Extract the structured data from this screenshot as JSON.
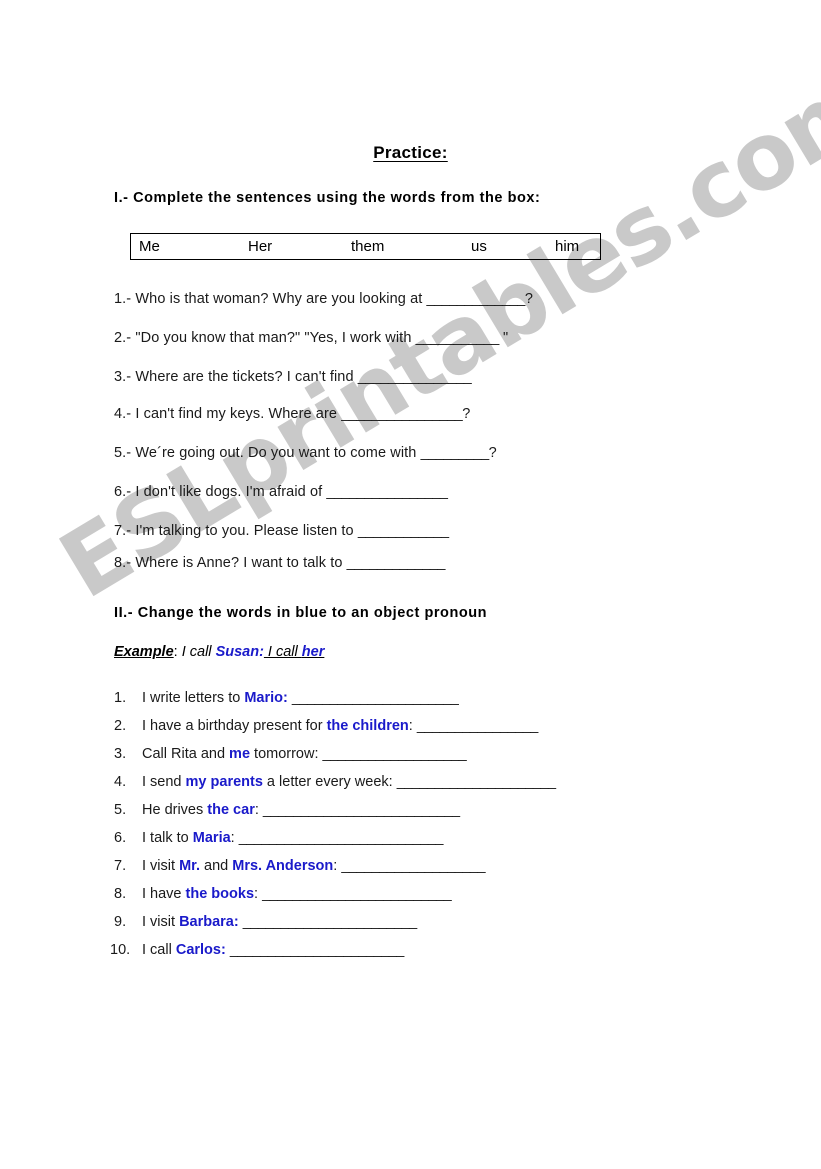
{
  "document": {
    "title": "Practice:",
    "watermark": "ESLprintables.com",
    "accent_blue": "#1a1aca",
    "text_color": "#1a1a1a"
  },
  "section1": {
    "heading": "I.- Complete the sentences using the words from the box:",
    "word_box": [
      "Me",
      "Her",
      "them",
      "us",
      "him"
    ],
    "items": [
      {
        "number": "1.-",
        "text": "Who is that woman?  Why are you looking at ",
        "blank": "_____________",
        "tail": "?"
      },
      {
        "number": "2.-",
        "text": "\"Do you know that man?\"  \"Yes, I work with ",
        "blank": "___________",
        "tail": " \""
      },
      {
        "number": "3.-",
        "text": "Where are the tickets? I can't find ",
        "blank": "_______________",
        "tail": ""
      },
      {
        "number": "4.-",
        "text": "I can't find my keys. Where are ",
        "blank": "________________",
        "tail": "?"
      },
      {
        "number": "5.-",
        "text": "We´re going out. Do you want to come with ",
        "blank": "_________",
        "tail": "?"
      },
      {
        "number": "6.-",
        "text": "I don't like dogs. I'm afraid of ",
        "blank": "________________",
        "tail": ""
      },
      {
        "number": "7.-",
        "text": "I'm talking to you. Please listen to ",
        "blank": "____________",
        "tail": ""
      },
      {
        "number": "8.-",
        "text": "Where is Anne? I want to talk to ",
        "blank": "_____________",
        "tail": ""
      }
    ]
  },
  "section2": {
    "heading": "II.- Change the words in blue to an object pronoun",
    "example": {
      "label": "Example",
      "colon": ":",
      "prompt": " I call ",
      "subject": "Susan:",
      "answer_plain": " I call ",
      "answer_blue": "her"
    },
    "items": [
      {
        "number": "1.",
        "pre": "I write letters to ",
        "blue": "Mario:",
        "post": "",
        "blank": "______________________"
      },
      {
        "number": "2.",
        "pre": "I have a birthday present for ",
        "blue": "the children",
        "post": ": ",
        "blank": "________________"
      },
      {
        "number": "3.",
        "pre": "Call Rita and ",
        "blue": "me",
        "post": " tomorrow: ",
        "blank": "___________________"
      },
      {
        "number": "4.",
        "pre": "I send ",
        "blue": "my parents",
        "post": " a letter every week: ",
        "blank": "_____________________"
      },
      {
        "number": "5.",
        "pre": "He drives ",
        "blue": "the car",
        "post": ": ",
        "blank": "__________________________"
      },
      {
        "number": "6.",
        "pre": "I talk to ",
        "blue": "Maria",
        "post": ": ",
        "blank": "___________________________"
      },
      {
        "number": "7.",
        "pre": "I visit ",
        "blue": "Mr.",
        "post": " and ",
        "blue2": "Mrs. Anderson",
        "post2": ": ",
        "blank": "___________________"
      },
      {
        "number": "8.",
        "pre": "I have ",
        "blue": "the books",
        "post": ": ",
        "blank": "_________________________"
      },
      {
        "number": "9.",
        "pre": "I visit ",
        "blue": "Barbara:",
        "post": " ",
        "blank": "_______________________"
      },
      {
        "number": "10.",
        "pre": "I call ",
        "blue": "Carlos:",
        "post": " ",
        "blank": "_______________________"
      }
    ]
  }
}
